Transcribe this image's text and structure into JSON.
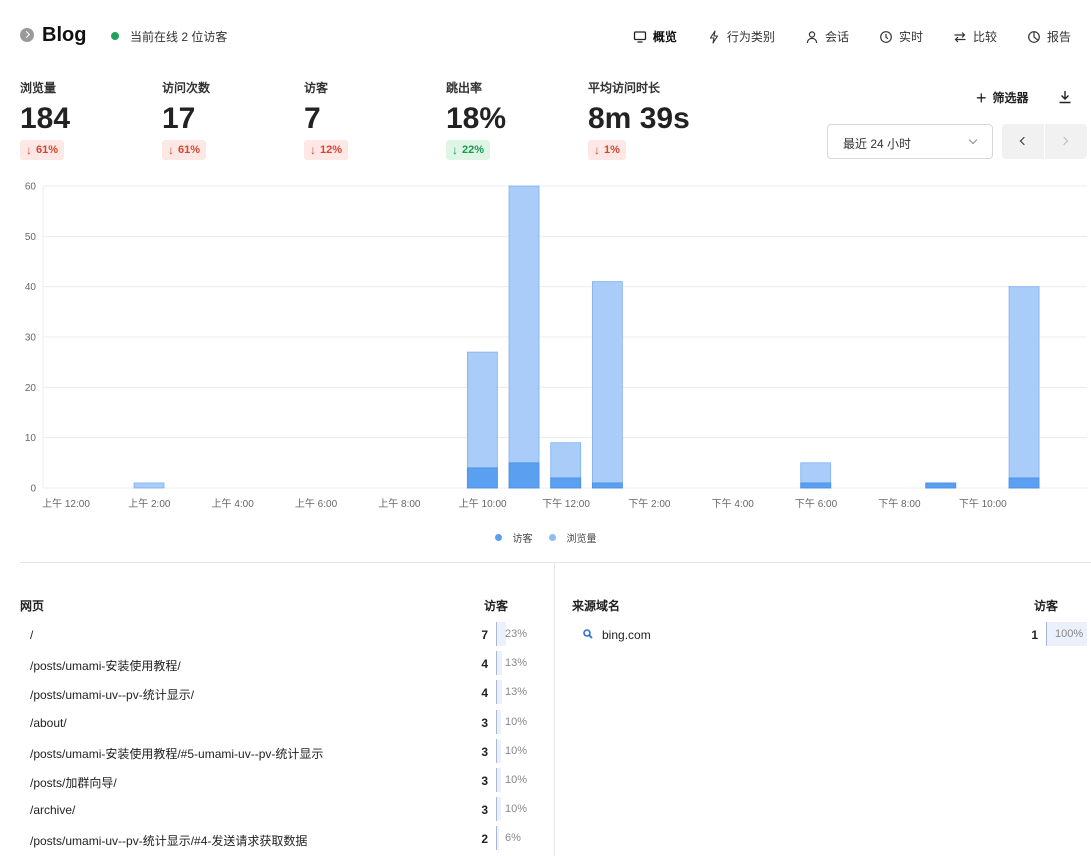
{
  "header": {
    "title": "Blog",
    "online": "当前在线 2 位访客",
    "nav": [
      {
        "label": "概览",
        "icon": "monitor-icon",
        "active": true
      },
      {
        "label": "行为类别",
        "icon": "bolt-icon",
        "active": false
      },
      {
        "label": "会话",
        "icon": "user-icon",
        "active": false
      },
      {
        "label": "实时",
        "icon": "clock-icon",
        "active": false
      },
      {
        "label": "比较",
        "icon": "swap-icon",
        "active": false
      },
      {
        "label": "报告",
        "icon": "pie-icon",
        "active": false
      }
    ]
  },
  "metrics": [
    {
      "label": "浏览量",
      "value": "184",
      "change": "61%",
      "direction": "down"
    },
    {
      "label": "访问次数",
      "value": "17",
      "change": "61%",
      "direction": "down"
    },
    {
      "label": "访客",
      "value": "7",
      "change": "12%",
      "direction": "down"
    },
    {
      "label": "跳出率",
      "value": "18%",
      "change": "22%",
      "direction": "up"
    },
    {
      "label": "平均访问时长",
      "value": "8m 39s",
      "change": "1%",
      "direction": "down"
    }
  ],
  "controls": {
    "filter_label": "筛选器",
    "date_range": "最近 24 小时"
  },
  "colors": {
    "visitors": "#5b9ff0",
    "views": "#a9ccf8",
    "accent_green": "#1fa35a"
  },
  "chart_data": {
    "type": "bar",
    "stacked": true,
    "x": [
      "上午 12:00",
      "上午 1:00",
      "上午 2:00",
      "上午 3:00",
      "上午 4:00",
      "上午 5:00",
      "上午 6:00",
      "上午 7:00",
      "上午 8:00",
      "上午 9:00",
      "上午 10:00",
      "上午 11:00",
      "下午 12:00",
      "下午 1:00",
      "下午 2:00",
      "下午 3:00",
      "下午 4:00",
      "下午 5:00",
      "下午 6:00",
      "下午 7:00",
      "下午 8:00",
      "下午 9:00",
      "下午 10:00",
      "下午 11:00"
    ],
    "tick_labels": [
      "上午 12:00",
      "上午 2:00",
      "上午 4:00",
      "上午 6:00",
      "上午 8:00",
      "上午 10:00",
      "下午 12:00",
      "下午 2:00",
      "下午 4:00",
      "下午 6:00",
      "下午 8:00",
      "下午 10:00"
    ],
    "series": [
      {
        "name": "访客",
        "values": [
          0,
          0,
          0,
          0,
          0,
          0,
          0,
          0,
          0,
          0,
          4,
          5,
          2,
          1,
          0,
          0,
          0,
          0,
          1,
          0,
          0,
          1,
          0,
          2
        ]
      },
      {
        "name": "浏览量",
        "values": [
          0,
          0,
          1,
          0,
          0,
          0,
          0,
          0,
          0,
          0,
          27,
          60,
          9,
          41,
          0,
          0,
          0,
          0,
          5,
          0,
          0,
          1,
          0,
          40
        ]
      }
    ],
    "ylim": [
      0,
      60
    ],
    "yticks": [
      0,
      10,
      20,
      30,
      40,
      50,
      60
    ],
    "grid": true,
    "legend": "bottom"
  },
  "pages_table": {
    "title": "网页",
    "col": "访客",
    "rows": [
      {
        "label": "/",
        "count": "7",
        "pct": "23%",
        "frac": 0.23
      },
      {
        "label": "/posts/umami-安装使用教程/",
        "count": "4",
        "pct": "13%",
        "frac": 0.13
      },
      {
        "label": "/posts/umami-uv--pv-统计显示/",
        "count": "4",
        "pct": "13%",
        "frac": 0.13
      },
      {
        "label": "/about/",
        "count": "3",
        "pct": "10%",
        "frac": 0.1
      },
      {
        "label": "/posts/umami-安装使用教程/#5-umami-uv--pv-统计显示",
        "count": "3",
        "pct": "10%",
        "frac": 0.1
      },
      {
        "label": "/posts/加群向导/",
        "count": "3",
        "pct": "10%",
        "frac": 0.1
      },
      {
        "label": "/archive/",
        "count": "3",
        "pct": "10%",
        "frac": 0.1
      },
      {
        "label": "/posts/umami-uv--pv-统计显示/#4-发送请求获取数据",
        "count": "2",
        "pct": "6%",
        "frac": 0.06
      }
    ]
  },
  "referrers_table": {
    "title": "来源域名",
    "col": "访客",
    "rows": [
      {
        "label": "bing.com",
        "count": "1",
        "pct": "100%",
        "frac": 1.0,
        "icon": "search-icon"
      }
    ]
  }
}
